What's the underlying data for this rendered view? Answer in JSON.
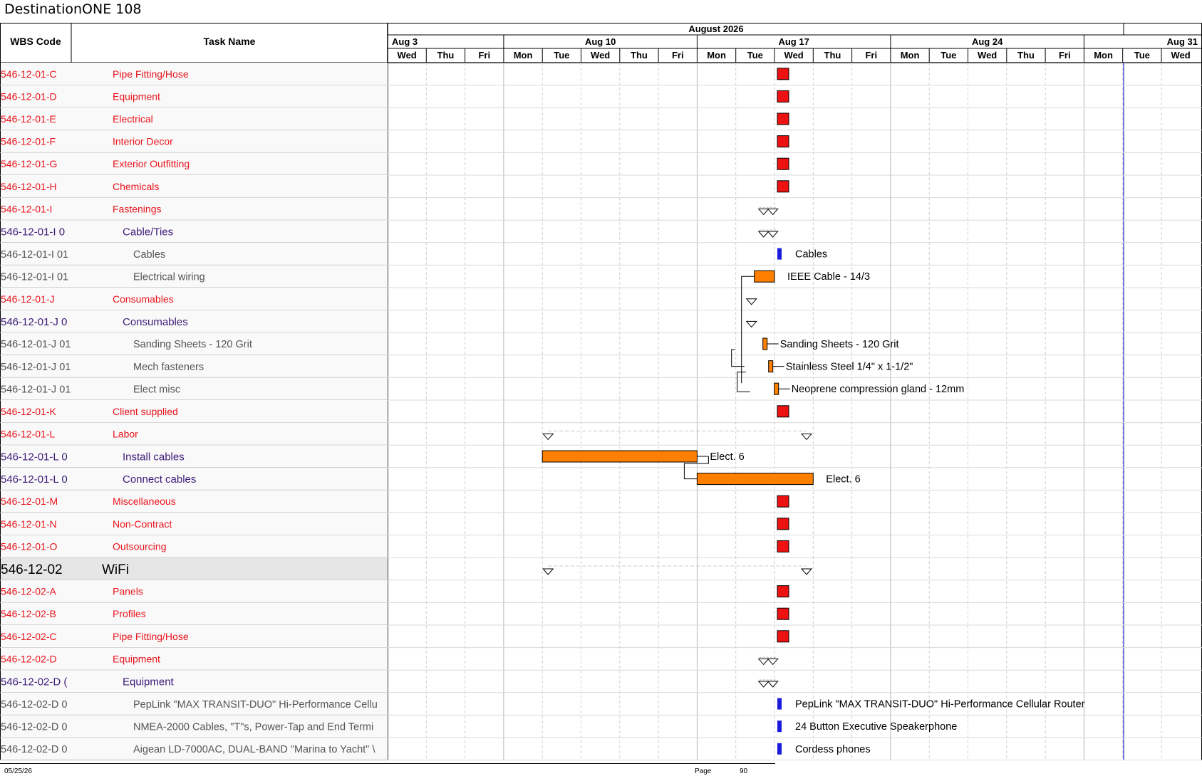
{
  "document": {
    "title": "DestinationONE 108",
    "footer_date": "05/25/26",
    "footer_page_label": "Page",
    "footer_page_number": "90"
  },
  "columns": {
    "wbs_header": "WBS Code",
    "task_header": "Task Name"
  },
  "timeline": {
    "month_label": "August 2026",
    "weeks": [
      "Aug 3",
      "Aug 10",
      "Aug 17",
      "Aug 24",
      "Aug 31"
    ],
    "days": [
      "Wed",
      "Thu",
      "Fri",
      "Mon",
      "Tue",
      "Wed",
      "Thu",
      "Fri",
      "Mon",
      "Tue",
      "Wed",
      "Thu",
      "Fri",
      "Mon",
      "Tue",
      "Wed",
      "Thu",
      "Fri",
      "Mon",
      "Tue",
      "Wed"
    ],
    "day_dates": [
      "2026-08-05",
      "2026-08-06",
      "2026-08-07",
      "2026-08-10",
      "2026-08-11",
      "2026-08-12",
      "2026-08-13",
      "2026-08-14",
      "2026-08-17",
      "2026-08-18",
      "2026-08-19",
      "2026-08-20",
      "2026-08-21",
      "2026-08-24",
      "2026-08-25",
      "2026-08-26",
      "2026-08-27",
      "2026-08-28",
      "2026-08-31",
      "2026-09-01",
      "2026-09-02"
    ],
    "week_start_dates": [
      "2026-08-05",
      "2026-08-10",
      "2026-08-17",
      "2026-08-24",
      "2026-08-31"
    ],
    "today_date": "2026-08-31",
    "colors": {
      "milestone": "#ee1111",
      "task_bar": "#ff8000",
      "blue_marker": "#1a1adc",
      "summary_row": "#e6e6e6",
      "link": "#000000",
      "today_line": "#3333cc",
      "level1_text": "#e8141c",
      "level2_text": "#3c1a78",
      "level3_text": "#555555"
    }
  },
  "rows": [
    {
      "wbs": "546-12-01-C",
      "task": "Pipe Fitting/Hose",
      "level": 1,
      "mark": {
        "type": "milestone",
        "date": "2026-08-19"
      }
    },
    {
      "wbs": "546-12-01-D",
      "task": "Equipment",
      "level": 1,
      "mark": {
        "type": "milestone",
        "date": "2026-08-19"
      }
    },
    {
      "wbs": "546-12-01-E",
      "task": "Electrical",
      "level": 1,
      "mark": {
        "type": "milestone",
        "date": "2026-08-19"
      }
    },
    {
      "wbs": "546-12-01-F",
      "task": "Interior Decor",
      "level": 1,
      "mark": {
        "type": "milestone",
        "date": "2026-08-19"
      }
    },
    {
      "wbs": "546-12-01-G",
      "task": "Exterior Outfitting",
      "level": 1,
      "mark": {
        "type": "milestone",
        "date": "2026-08-19"
      }
    },
    {
      "wbs": "546-12-01-H",
      "task": "Chemicals",
      "level": 1,
      "mark": {
        "type": "milestone",
        "date": "2026-08-19"
      }
    },
    {
      "wbs": "546-12-01-I",
      "task": "Fastenings",
      "level": 1,
      "mark": {
        "type": "summary",
        "start": "2026-08-18",
        "end": "2026-08-19"
      }
    },
    {
      "wbs": "546-12-01-I 0",
      "task": "Cable/Ties",
      "level": 2,
      "mark": {
        "type": "summary",
        "start": "2026-08-18",
        "end": "2026-08-19"
      }
    },
    {
      "wbs": "546-12-01-I 01",
      "task": "Cables",
      "level": 3,
      "mark": {
        "type": "blue",
        "date": "2026-08-19",
        "label": "Cables"
      }
    },
    {
      "wbs": "546-12-01-I 01",
      "task": "Electrical wiring",
      "level": 3,
      "mark": {
        "type": "bar",
        "start": "2026-08-18",
        "end": "2026-08-19",
        "label": "IEEE Cable - 14/3"
      }
    },
    {
      "wbs": "546-12-01-J",
      "task": "Consumables",
      "level": 1,
      "mark": {
        "type": "summary",
        "start": "2026-08-18",
        "end": "2026-08-18"
      }
    },
    {
      "wbs": "546-12-01-J 0",
      "task": "Consumables",
      "level": 2,
      "mark": {
        "type": "summary",
        "start": "2026-08-18",
        "end": "2026-08-18"
      }
    },
    {
      "wbs": "546-12-01-J 01",
      "task": "Sanding Sheets - 120 Grit",
      "level": 3,
      "mark": {
        "type": "bar",
        "start": "2026-08-18",
        "end": "2026-08-18",
        "label": "Sanding Sheets - 120 Grit"
      }
    },
    {
      "wbs": "546-12-01-J 01",
      "task": "Mech fasteners",
      "level": 3,
      "mark": {
        "type": "bar",
        "start": "2026-08-18",
        "end": "2026-08-18",
        "label": "Stainless Steel 1/4\" x 1-1/2\""
      }
    },
    {
      "wbs": "546-12-01-J 01",
      "task": "Elect misc",
      "level": 3,
      "mark": {
        "type": "bar",
        "start": "2026-08-18",
        "end": "2026-08-18",
        "label": "Neoprene compression gland - 12mm"
      }
    },
    {
      "wbs": "546-12-01-K",
      "task": "Client supplied",
      "level": 1,
      "mark": {
        "type": "milestone",
        "date": "2026-08-19"
      }
    },
    {
      "wbs": "546-12-01-L",
      "task": "Labor",
      "level": 1,
      "mark": {
        "type": "summary",
        "start": "2026-08-11",
        "end": "2026-08-19"
      }
    },
    {
      "wbs": "546-12-01-L 0",
      "task": "Install cables",
      "level": 2,
      "mark": {
        "type": "bar",
        "start": "2026-08-11",
        "end": "2026-08-14",
        "label": "Elect. 6"
      }
    },
    {
      "wbs": "546-12-01-L 0",
      "task": "Connect cables",
      "level": 2,
      "mark": {
        "type": "bar",
        "start": "2026-08-17",
        "end": "2026-08-19",
        "label": "Elect. 6"
      }
    },
    {
      "wbs": "546-12-01-M",
      "task": "Miscellaneous",
      "level": 1,
      "mark": {
        "type": "milestone",
        "date": "2026-08-19"
      }
    },
    {
      "wbs": "546-12-01-N",
      "task": "Non-Contract",
      "level": 1,
      "mark": {
        "type": "milestone",
        "date": "2026-08-19"
      }
    },
    {
      "wbs": "546-12-01-O",
      "task": "Outsourcing",
      "level": 1,
      "mark": {
        "type": "milestone",
        "date": "2026-08-19"
      }
    },
    {
      "wbs": "546-12-02",
      "task": "WiFi",
      "level": 0,
      "mark": {
        "type": "summary",
        "start": "2026-08-11",
        "end": "2026-08-19"
      }
    },
    {
      "wbs": "546-12-02-A",
      "task": "Panels",
      "level": 1,
      "mark": {
        "type": "milestone",
        "date": "2026-08-19"
      }
    },
    {
      "wbs": "546-12-02-B",
      "task": "Profiles",
      "level": 1,
      "mark": {
        "type": "milestone",
        "date": "2026-08-19"
      }
    },
    {
      "wbs": "546-12-02-C",
      "task": "Pipe Fitting/Hose",
      "level": 1,
      "mark": {
        "type": "milestone",
        "date": "2026-08-19"
      }
    },
    {
      "wbs": "546-12-02-D",
      "task": "Equipment",
      "level": 1,
      "mark": {
        "type": "summary",
        "start": "2026-08-18",
        "end": "2026-08-19"
      }
    },
    {
      "wbs": "546-12-02-D (",
      "task": "Equipment",
      "level": 2,
      "mark": {
        "type": "summary",
        "start": "2026-08-18",
        "end": "2026-08-19"
      }
    },
    {
      "wbs": "546-12-02-D 0",
      "task": "PepLink \"MAX TRANSIT-DUO\" Hi-Performance Cellu",
      "level": 3,
      "mark": {
        "type": "blue",
        "date": "2026-08-19",
        "label": "PepLink \"MAX TRANSIT-DUO\" Hi-Performance Cellular Router"
      }
    },
    {
      "wbs": "546-12-02-D 0",
      "task": "NMEA-2000 Cables, \"T\"s, Power-Tap and End Termi",
      "level": 3,
      "mark": {
        "type": "blue",
        "date": "2026-08-19",
        "label": "24 Button Executive Speakerphone"
      }
    },
    {
      "wbs": "546-12-02-D 0",
      "task": "Aigean LD-7000AC, DUAL-BAND \"Marina to Yacht\" \\",
      "level": 3,
      "mark": {
        "type": "blue",
        "date": "2026-08-19",
        "label": "Cordess phones"
      }
    }
  ]
}
